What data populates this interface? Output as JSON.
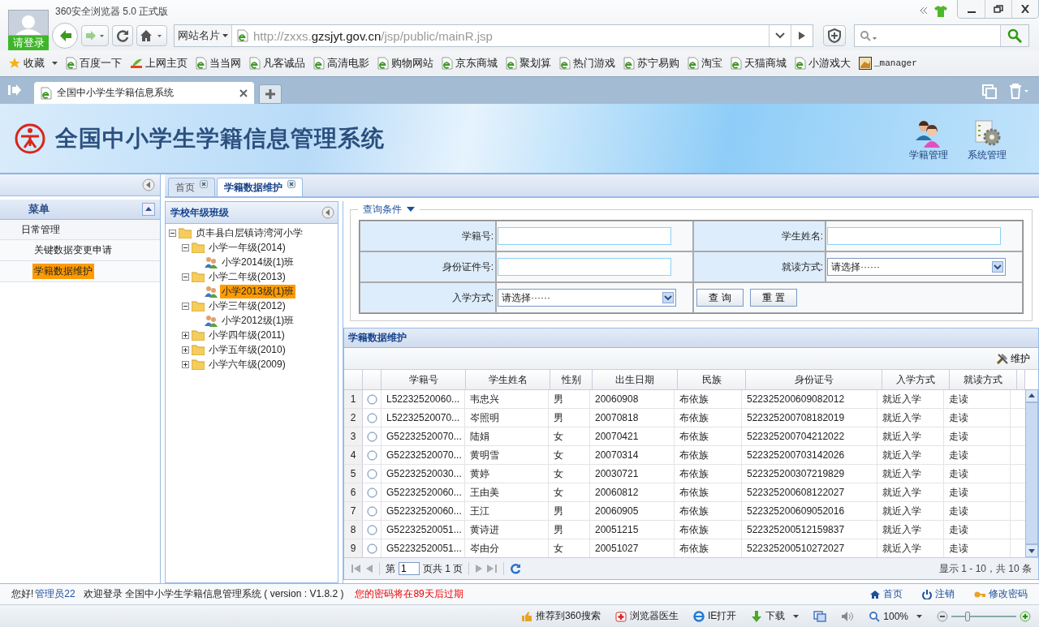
{
  "browser": {
    "title": "360安全浏览器 5.0 正式版",
    "login": "请登录",
    "address_menu": "网站名片",
    "url_prefix": "http://zxxs.",
    "url_domain": "gzsjyt.gov.cn",
    "url_path": "/jsp/public/mainR.jsp",
    "favorites": "收藏",
    "bookmarks": [
      {
        "label": "百度一下",
        "kind": "page"
      },
      {
        "label": "上网主页",
        "kind": "hao"
      },
      {
        "label": "当当网",
        "kind": "page"
      },
      {
        "label": "凡客诚品",
        "kind": "page"
      },
      {
        "label": "高清电影",
        "kind": "page"
      },
      {
        "label": "购物网站",
        "kind": "page"
      },
      {
        "label": "京东商城",
        "kind": "page"
      },
      {
        "label": "聚划算",
        "kind": "page"
      },
      {
        "label": "热门游戏",
        "kind": "page"
      },
      {
        "label": "苏宁易购",
        "kind": "page"
      },
      {
        "label": "淘宝",
        "kind": "page"
      },
      {
        "label": "天猫商城",
        "kind": "page"
      },
      {
        "label": "小游戏大",
        "kind": "page"
      },
      {
        "label": "_manager",
        "kind": "image"
      }
    ],
    "tab": "全国中小学生学籍信息系统",
    "status_items": [
      "推荐到360搜索",
      "浏览器医生",
      "IE打开",
      "下载"
    ],
    "zoom": "100%",
    "zoom_slider": {
      "level": 0.25
    }
  },
  "page": {
    "title": "全国中小学生学籍信息管理系统",
    "header_nav": [
      "学籍管理",
      "系统管理"
    ],
    "menu": {
      "title": "菜单",
      "groups": [
        {
          "label": "日常管理",
          "children": [
            {
              "label": "关键数据变更申请",
              "selected": false
            },
            {
              "label": "学籍数据维护",
              "selected": true
            }
          ]
        }
      ]
    },
    "tabs": [
      {
        "label": "首页",
        "selected": false
      },
      {
        "label": "学籍数据维护",
        "selected": true
      }
    ],
    "tree": {
      "title": "学校年级班级",
      "nodes": [
        {
          "label": "贞丰县白层镇诗湾河小学",
          "expanded": true,
          "selected": false,
          "children": [
            {
              "label": "小学一年级(2014)",
              "expanded": true,
              "selected": false,
              "children": [
                {
                  "label": "小学2014级(1)班",
                  "selected": false
                }
              ]
            },
            {
              "label": "小学二年级(2013)",
              "expanded": true,
              "selected": false,
              "children": [
                {
                  "label": "小学2013级(1)班",
                  "selected": true
                }
              ]
            },
            {
              "label": "小学三年级(2012)",
              "expanded": true,
              "selected": false,
              "children": [
                {
                  "label": "小学2012级(1)班",
                  "selected": false
                }
              ]
            },
            {
              "label": "小学四年级(2011)",
              "expanded": false,
              "selected": false
            },
            {
              "label": "小学五年级(2010)",
              "expanded": false,
              "selected": false
            },
            {
              "label": "小学六年级(2009)",
              "expanded": false,
              "selected": false
            }
          ]
        }
      ]
    },
    "query": {
      "legend": "查询条件",
      "fields": [
        {
          "label": "学籍号:",
          "kind": "text"
        },
        {
          "label": "学生姓名:",
          "kind": "text"
        },
        {
          "label": "身份证件号:",
          "kind": "text"
        },
        {
          "label": "就读方式:",
          "kind": "select",
          "value": "请选择······"
        },
        {
          "label": "入学方式:",
          "kind": "select",
          "value": "请选择······"
        }
      ],
      "buttons": [
        "查 询",
        "重 置"
      ]
    },
    "grid": {
      "title": "学籍数据维护",
      "tool": "维护",
      "columns": [
        "学籍号",
        "学生姓名",
        "性别",
        "出生日期",
        "民族",
        "身份证号",
        "入学方式",
        "就读方式"
      ],
      "rows": [
        {
          "n": "1",
          "selected": false,
          "cells": [
            "L52232520060...",
            "韦忠兴",
            "男",
            "20060908",
            "布依族",
            "522325200609082012",
            "就近入学",
            "走读"
          ]
        },
        {
          "n": "2",
          "selected": false,
          "cells": [
            "L52232520070...",
            "岑照明",
            "男",
            "20070818",
            "布依族",
            "522325200708182019",
            "就近入学",
            "走读"
          ]
        },
        {
          "n": "3",
          "selected": false,
          "cells": [
            "G52232520070...",
            "陆娟",
            "女",
            "20070421",
            "布依族",
            "522325200704212022",
            "就近入学",
            "走读"
          ]
        },
        {
          "n": "4",
          "selected": false,
          "cells": [
            "G52232520070...",
            "黄明雪",
            "女",
            "20070314",
            "布依族",
            "522325200703142026",
            "就近入学",
            "走读"
          ]
        },
        {
          "n": "5",
          "selected": false,
          "cells": [
            "G52232520030...",
            "黄婷",
            "女",
            "20030721",
            "布依族",
            "522325200307219829",
            "就近入学",
            "走读"
          ]
        },
        {
          "n": "6",
          "selected": false,
          "cells": [
            "G52232520060...",
            "王由美",
            "女",
            "20060812",
            "布依族",
            "522325200608122027",
            "就近入学",
            "走读"
          ]
        },
        {
          "n": "7",
          "selected": false,
          "cells": [
            "G52232520060...",
            "王江",
            "男",
            "20060905",
            "布依族",
            "522325200609052016",
            "就近入学",
            "走读"
          ]
        },
        {
          "n": "8",
          "selected": false,
          "cells": [
            "G52232520051...",
            "黄诗进",
            "男",
            "20051215",
            "布依族",
            "522325200512159837",
            "就近入学",
            "走读"
          ]
        },
        {
          "n": "9",
          "selected": false,
          "cells": [
            "G52232520051...",
            "岑由分",
            "女",
            "20051027",
            "布依族",
            "522325200510272027",
            "就近入学",
            "走读"
          ]
        }
      ],
      "pager": {
        "page_label": "第",
        "page": "1",
        "total": "页共 1 页",
        "summary": "显示 1 - 10，共 10 条"
      }
    },
    "footer": {
      "greeting": "您好!",
      "user": "管理员22",
      "welcome": "欢迎登录 全国中小学生学籍信息管理系统 ( version : V1.8.2 )",
      "warning": "您的密码将在89天后过期",
      "links": [
        "首页",
        "注销",
        "修改密码"
      ]
    }
  }
}
